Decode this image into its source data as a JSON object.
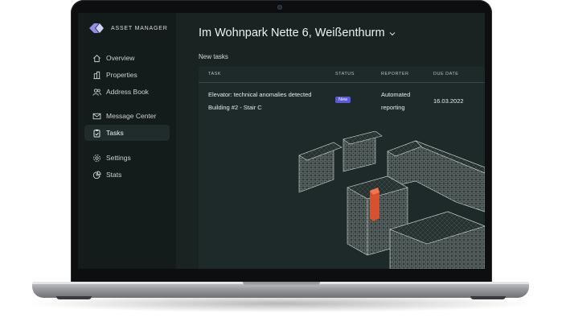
{
  "app": {
    "brand_name": "ASSET MANAGER",
    "accent_color": "#5b5bd6",
    "highlight_color": "#e0532b"
  },
  "sidebar": {
    "items": [
      {
        "label": "Overview",
        "icon": "home-icon",
        "active": false
      },
      {
        "label": "Properties",
        "icon": "buildings-icon",
        "active": false
      },
      {
        "label": "Address Book",
        "icon": "users-icon",
        "active": false
      },
      {
        "label": "Message Center",
        "icon": "mail-icon",
        "active": false
      },
      {
        "label": "Tasks",
        "icon": "clipboard-icon",
        "active": true
      },
      {
        "label": "Settings",
        "icon": "gear-icon",
        "active": false
      },
      {
        "label": "Stats",
        "icon": "pie-chart-icon",
        "active": false
      }
    ]
  },
  "header": {
    "title": "Im Wohnpark Nette 6, Weißenthurm",
    "section_title": "New tasks"
  },
  "tasks_table": {
    "columns": [
      "TASK",
      "STATUS",
      "REPORTER",
      "DUE DATE"
    ],
    "rows": [
      {
        "task_line1": "Elevator: technical anomalies detected",
        "task_line2": "Building #2 - Stair C",
        "status": "New",
        "reporter_line1": "Automated",
        "reporter_line2": "reporting",
        "due_date": "16.03.2022"
      }
    ]
  }
}
